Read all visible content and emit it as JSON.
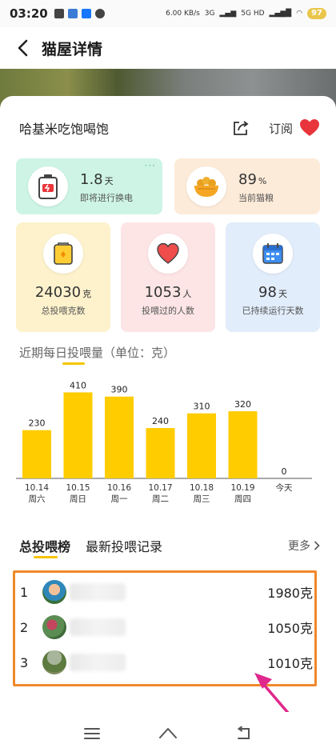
{
  "status_bar": {
    "time": "03:20",
    "net_speed": "6.00 KB/s",
    "signal_1": "3G",
    "signal_2": "5G HD",
    "battery": "97"
  },
  "header": {
    "title": "猫屋详情"
  },
  "house": {
    "name": "哈基米吃饱喝饱",
    "subscribe_label": "订阅"
  },
  "tiles": {
    "battery": {
      "value": "1.8",
      "unit": "天",
      "label": "即将进行换电",
      "more": "···"
    },
    "food": {
      "value": "89",
      "unit": "%",
      "label": "当前猫粮"
    }
  },
  "stats": [
    {
      "value": "24030",
      "unit": "克",
      "label": "总投喂克数"
    },
    {
      "value": "1053",
      "unit": "人",
      "label": "投喂过的人数"
    },
    {
      "value": "98",
      "unit": "天",
      "label": "已持续运行天数"
    }
  ],
  "chart_title": "近期每日投喂量（单位：克）",
  "chart_data": {
    "type": "bar",
    "categories": [
      "10.14 周六",
      "10.15 周日",
      "10.16 周一",
      "10.17 周二",
      "10.18 周三",
      "10.19 周四",
      "今天"
    ],
    "dates": [
      "10.14",
      "10.15",
      "10.16",
      "10.17",
      "10.18",
      "10.19",
      ""
    ],
    "weekdays": [
      "周六",
      "周日",
      "周一",
      "周二",
      "周三",
      "周四",
      "今天"
    ],
    "values": [
      230,
      410,
      390,
      240,
      310,
      320,
      0
    ],
    "bar_color": "#ffcc00",
    "ylim": [
      0,
      450
    ],
    "grid": false
  },
  "tabs": {
    "ranking_label": "总投喂榜",
    "records_label": "最新投喂记录",
    "more_label": "更多"
  },
  "ranking": [
    {
      "rank": "1",
      "amount": "1980克"
    },
    {
      "rank": "2",
      "amount": "1050克"
    },
    {
      "rank": "3",
      "amount": "1010克"
    }
  ],
  "colors": {
    "accent_yellow": "#f5c400",
    "highlight_box": "#f0882b",
    "annotation_arrow": "#e0288c",
    "heart_red": "#e8353b"
  }
}
